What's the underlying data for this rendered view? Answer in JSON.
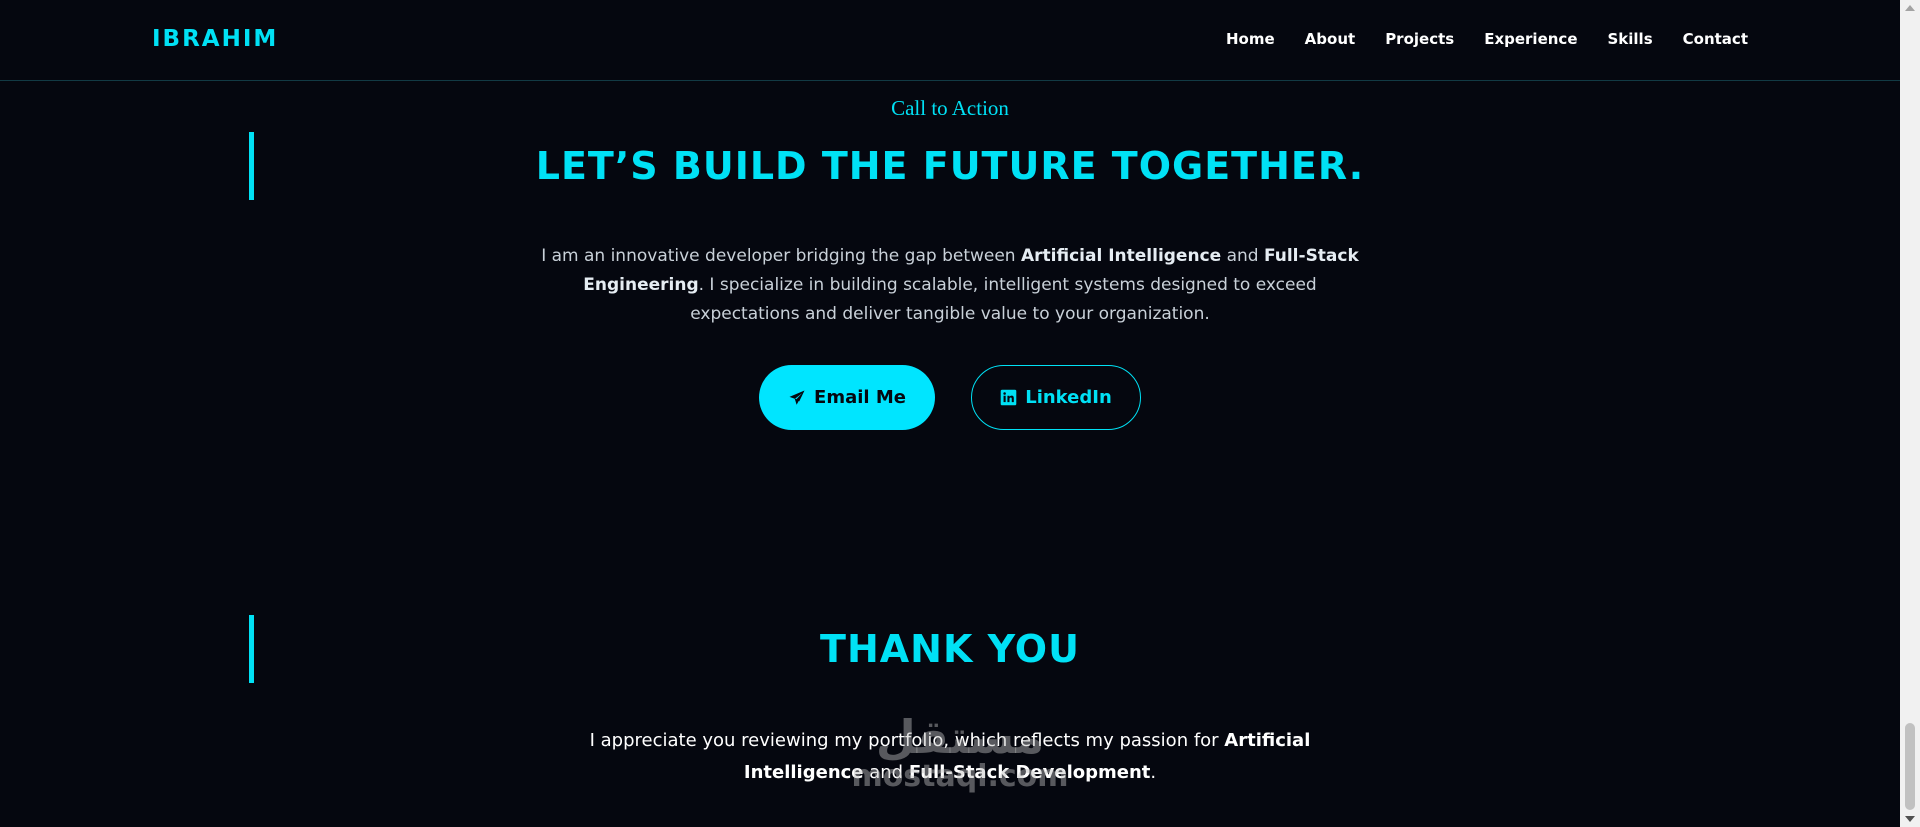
{
  "brand": {
    "logo": "IBRAHIM",
    "accent_color": "#00e1f5",
    "background_color": "#05070f"
  },
  "nav": {
    "items": [
      {
        "label": "Home"
      },
      {
        "label": "About"
      },
      {
        "label": "Projects"
      },
      {
        "label": "Experience"
      },
      {
        "label": "Skills"
      },
      {
        "label": "Contact"
      }
    ]
  },
  "cta": {
    "eyebrow": "Call to Action",
    "title": "LET’S BUILD THE FUTURE TOGETHER.",
    "text_1": "I am an innovative developer bridging the gap between ",
    "bold_1": "Artificial Intelligence",
    "text_2": " and ",
    "bold_2": "Full-Stack Engineering",
    "text_3": ". I specialize in building scalable, intelligent systems designed to exceed expectations and deliver tangible value to your organization.",
    "email_button": {
      "label": "Email Me",
      "icon": "paper-plane-icon"
    },
    "linkedin_button": {
      "label": "LinkedIn",
      "icon": "linkedin-icon"
    }
  },
  "thanks": {
    "title": "THANK YOU",
    "text_1": "I appreciate you reviewing my portfolio, which reflects my passion for ",
    "bold_1": "Artificial Intelligence",
    "text_2": " and ",
    "bold_2": "Full-Stack Development",
    "text_3": "."
  },
  "watermark": {
    "arabic": "مستقل",
    "latin": "mostaql.com"
  }
}
